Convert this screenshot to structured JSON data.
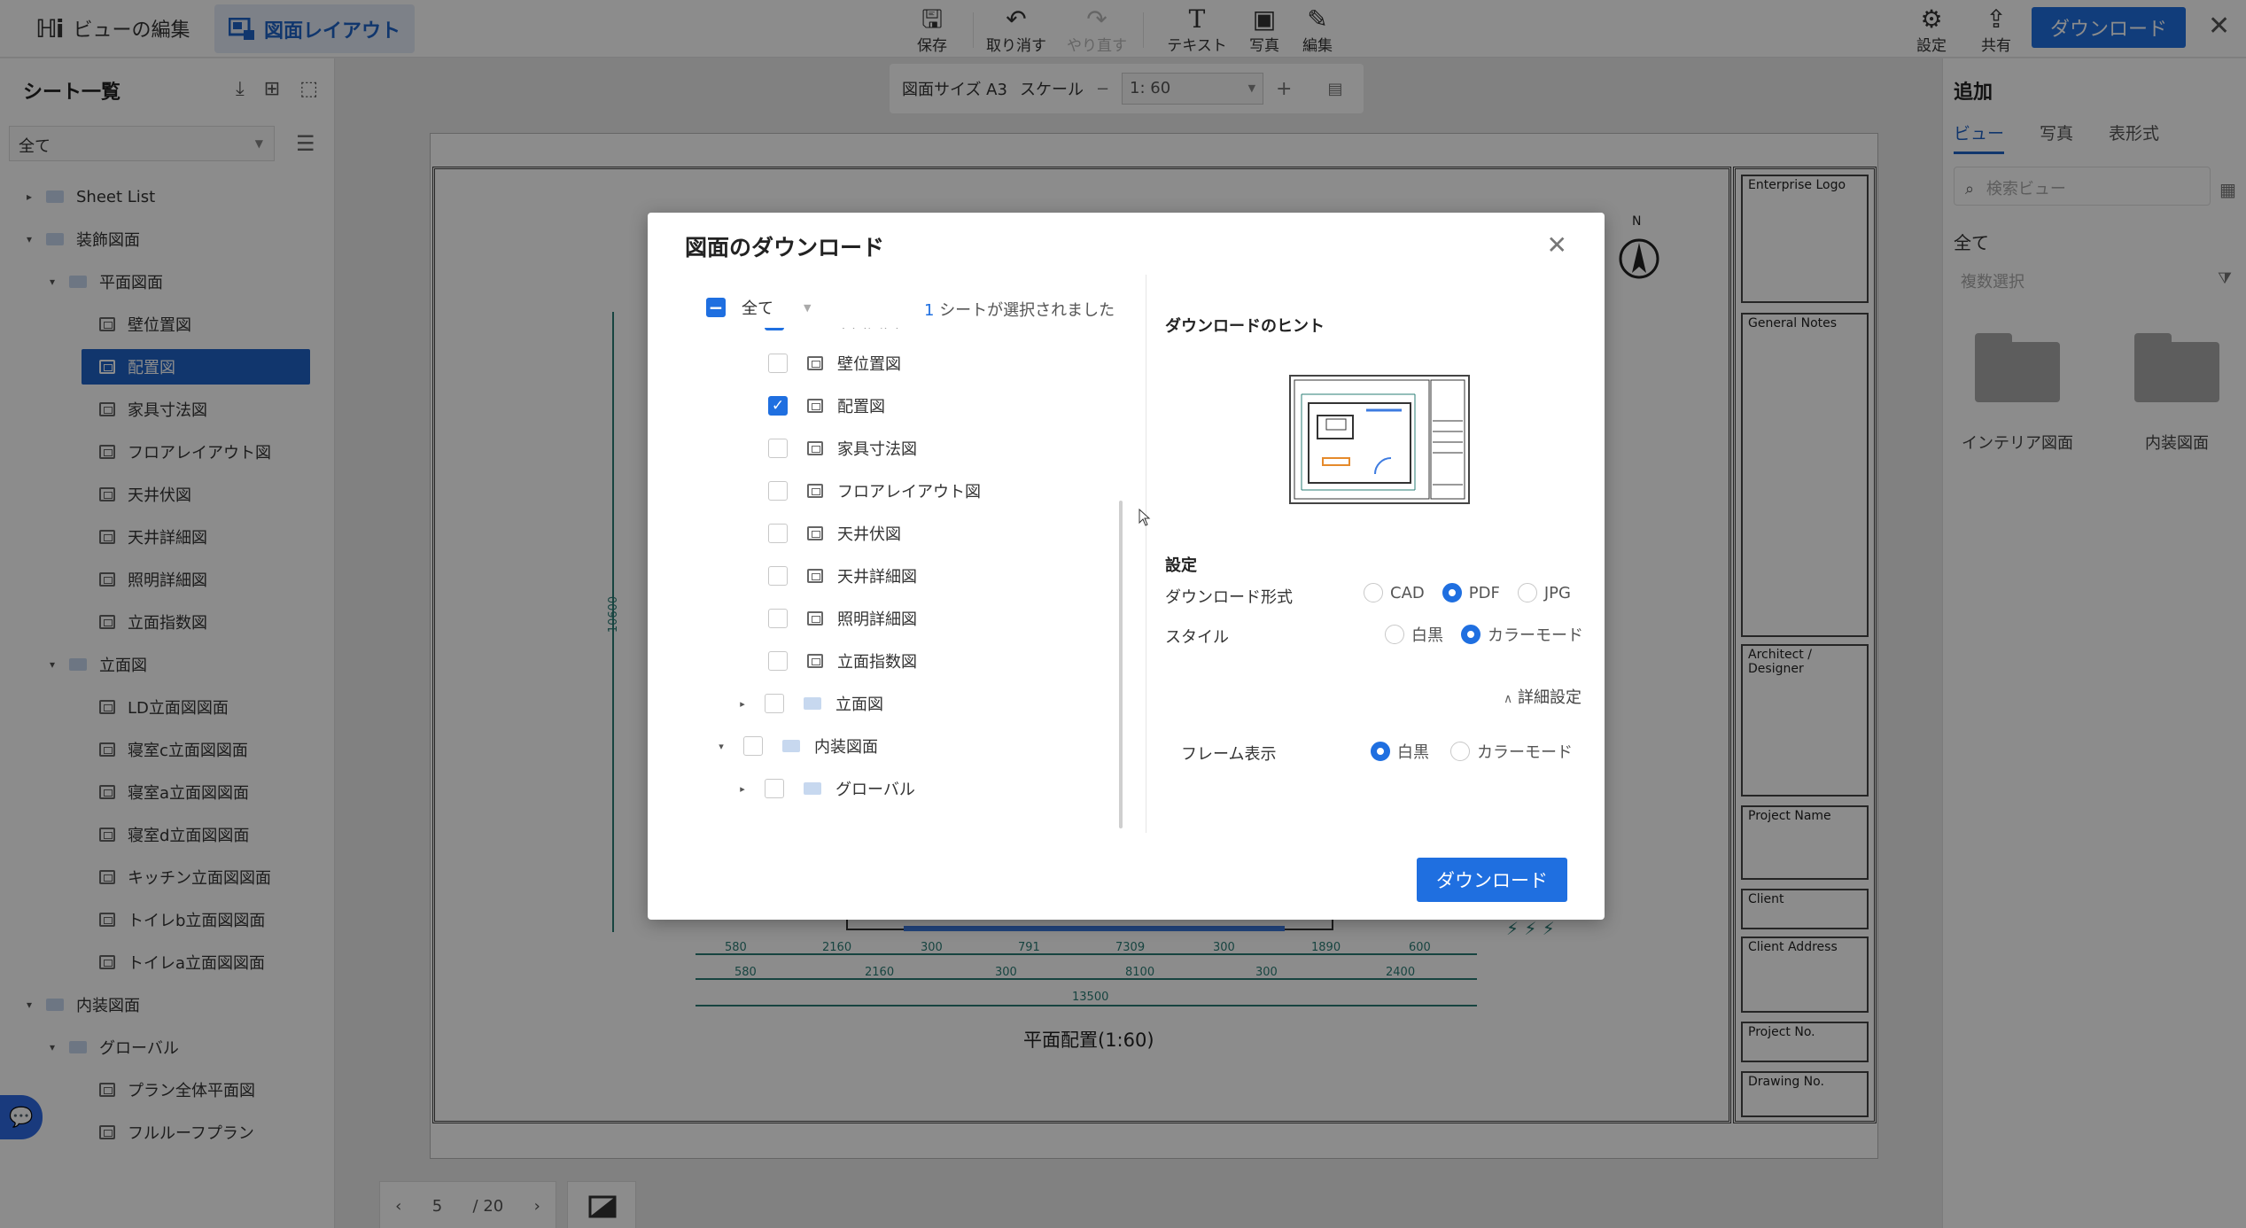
{
  "topbar": {
    "edit_view": "ビューの編集",
    "layout": "図面レイアウト",
    "tools": [
      {
        "label": "保存",
        "icon": "save-icon"
      },
      {
        "label": "取り消す",
        "icon": "undo-icon"
      },
      {
        "label": "やり直す",
        "icon": "redo-icon"
      },
      {
        "label": "テキスト",
        "icon": "text-icon"
      },
      {
        "label": "写真",
        "icon": "photo-icon"
      },
      {
        "label": "編集",
        "icon": "edit-icon"
      }
    ],
    "settings": "設定",
    "share": "共有",
    "download": "ダウンロード"
  },
  "sidebar": {
    "title": "シート一覧",
    "filter": "全て",
    "items": [
      {
        "label": "Sheet List",
        "type": "folder",
        "level": 0,
        "arrow": "▸"
      },
      {
        "label": "装飾図面",
        "type": "folder",
        "level": 0,
        "arrow": "▾"
      },
      {
        "label": "平面図面",
        "type": "folder",
        "level": 1,
        "arrow": "▾"
      },
      {
        "label": "壁位置図",
        "type": "sheet",
        "level": 2
      },
      {
        "label": "配置図",
        "type": "sheet",
        "level": 2,
        "selected": true
      },
      {
        "label": "家具寸法図",
        "type": "sheet",
        "level": 2
      },
      {
        "label": "フロアレイアウト図",
        "type": "sheet",
        "level": 2
      },
      {
        "label": "天井伏図",
        "type": "sheet",
        "level": 2
      },
      {
        "label": "天井詳細図",
        "type": "sheet",
        "level": 2
      },
      {
        "label": "照明詳細図",
        "type": "sheet",
        "level": 2
      },
      {
        "label": "立面指数図",
        "type": "sheet",
        "level": 2
      },
      {
        "label": "立面図",
        "type": "folder",
        "level": 1,
        "arrow": "▾"
      },
      {
        "label": "LD立面図図面",
        "type": "sheet",
        "level": 2
      },
      {
        "label": "寝室c立面図図面",
        "type": "sheet",
        "level": 2
      },
      {
        "label": "寝室a立面図図面",
        "type": "sheet",
        "level": 2
      },
      {
        "label": "寝室d立面図図面",
        "type": "sheet",
        "level": 2
      },
      {
        "label": "キッチン立面図図面",
        "type": "sheet",
        "level": 2
      },
      {
        "label": "トイレb立面図図面",
        "type": "sheet",
        "level": 2
      },
      {
        "label": "トイレa立面図図面",
        "type": "sheet",
        "level": 2
      },
      {
        "label": "内装図面",
        "type": "folder",
        "level": 0,
        "arrow": "▾"
      },
      {
        "label": "グローバル",
        "type": "folder",
        "level": 1,
        "arrow": "▾"
      },
      {
        "label": "プラン全体平面図",
        "type": "sheet",
        "level": 2
      },
      {
        "label": "フルルーフプラン",
        "type": "sheet",
        "level": 2
      }
    ]
  },
  "scalebar": {
    "size": "図面サイズ A3",
    "scale_label": "スケール",
    "scale_value": "1: 60"
  },
  "drawing": {
    "caption": "平面配置(1:60)",
    "north": "N",
    "dims_row1": [
      "580",
      "2160",
      "300",
      "791",
      "7309",
      "300",
      "1890",
      "600"
    ],
    "dims_row2": [
      "580",
      "2160",
      "300",
      "8100",
      "300",
      "2400"
    ],
    "dims_total": "13500",
    "vertical_dim": "10600",
    "titleblock": [
      "Enterprise Logo",
      "General Notes",
      "Architect / Designer",
      "Project Name",
      "Client",
      "Client Address",
      "Project No.",
      "Drawing No."
    ]
  },
  "pager": {
    "current": "5",
    "total": "/ 20"
  },
  "rightpanel": {
    "title": "追加",
    "tabs": [
      "ビュー",
      "写真",
      "表形式"
    ],
    "search_placeholder": "検索ビュー",
    "all": "全て",
    "multi_select": "複数選択",
    "folders": [
      "インテリア図面",
      "内装図面"
    ]
  },
  "modal": {
    "title": "図面のダウンロード",
    "select_all": "全て",
    "selected_count": "1",
    "selected_text": "シートが選択されました",
    "tree": [
      {
        "label": "平面図面",
        "type": "folder",
        "checked": "partial",
        "partial_visible": true
      },
      {
        "label": "壁位置図",
        "type": "sheet",
        "checked": false
      },
      {
        "label": "配置図",
        "type": "sheet",
        "checked": true
      },
      {
        "label": "家具寸法図",
        "type": "sheet",
        "checked": false
      },
      {
        "label": "フロアレイアウト図",
        "type": "sheet",
        "checked": false
      },
      {
        "label": "天井伏図",
        "type": "sheet",
        "checked": false
      },
      {
        "label": "天井詳細図",
        "type": "sheet",
        "checked": false
      },
      {
        "label": "照明詳細図",
        "type": "sheet",
        "checked": false
      },
      {
        "label": "立面指数図",
        "type": "sheet",
        "checked": false
      },
      {
        "label": "立面図",
        "type": "folder",
        "checked": false,
        "arrow": "▸"
      },
      {
        "label": "内装図面",
        "type": "folder",
        "checked": false,
        "arrow": "▾"
      },
      {
        "label": "グローバル",
        "type": "folder",
        "checked": false,
        "arrow": "▸"
      }
    ],
    "hint_title": "ダウンロードのヒント",
    "settings_title": "設定",
    "format_label": "ダウンロード形式",
    "formats": [
      {
        "label": "CAD",
        "on": false
      },
      {
        "label": "PDF",
        "on": true
      },
      {
        "label": "JPG",
        "on": false
      }
    ],
    "style_label": "スタイル",
    "styles": [
      {
        "label": "白黒",
        "on": false
      },
      {
        "label": "カラーモード",
        "on": true
      }
    ],
    "advanced": "詳細設定",
    "frame_label": "フレーム表示",
    "frame_styles": [
      {
        "label": "白黒",
        "on": true
      },
      {
        "label": "カラーモード",
        "on": false
      }
    ],
    "download": "ダウンロード"
  },
  "colors": {
    "accent": "#1f6fe0",
    "selected": "#1f63c6",
    "drawing_line": "#2a7c76"
  }
}
